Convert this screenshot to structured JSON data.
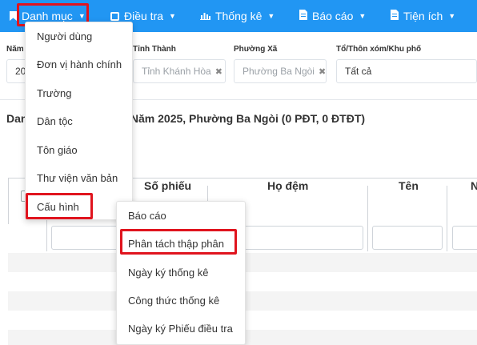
{
  "topnav": {
    "items": [
      {
        "label": "Danh mục",
        "icon": "flag-icon"
      },
      {
        "label": "Điều tra",
        "icon": "user-card-icon"
      },
      {
        "label": "Thống kê",
        "icon": "bar-chart-icon"
      },
      {
        "label": "Báo cáo",
        "icon": "document-icon"
      },
      {
        "label": "Tiện ích",
        "icon": "document-icon"
      }
    ]
  },
  "filters": {
    "year_label": "Năm",
    "year_value": "20",
    "province_label": "Tỉnh Thành",
    "province_value": "Tỉnh Khánh Hòa",
    "ward_label": "Phường Xã",
    "ward_value": "Phường Ba Ngòi",
    "hamlet_label": "Tổ/Thôn xóm/Khu phố",
    "hamlet_value": "Tất cả"
  },
  "page_title_prefix": "Dan",
  "page_title_suffix": "n Năm 2025, Phường Ba Ngòi (0 PĐT, 0 ĐTĐT)",
  "table": {
    "columns": [
      "Số phiếu",
      "Họ đệm",
      "Tên",
      "N"
    ]
  },
  "danh_muc_menu": {
    "items": [
      "Người dùng",
      "Đơn vị hành chính",
      "Trường",
      "Dân tộc",
      "Tôn giáo",
      "Thư viện văn bản",
      "Cấu hình"
    ]
  },
  "cau_hinh_submenu": {
    "items": [
      "Báo cáo",
      "Phân tách thập phân",
      "Ngày ký thống kê",
      "Công thức thống kê",
      "Ngày ký Phiếu điều tra"
    ]
  },
  "colors": {
    "nav_bg": "#2196f3",
    "highlight": "#e0141e"
  }
}
